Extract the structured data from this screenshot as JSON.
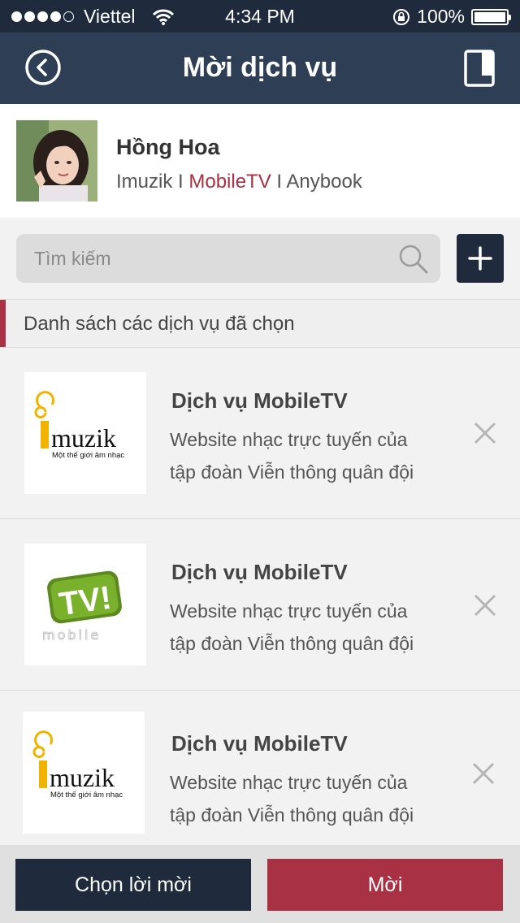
{
  "status_bar": {
    "carrier": "Viettel",
    "time": "4:34 PM",
    "battery": "100%",
    "signal_bars": 4
  },
  "nav": {
    "title": "Mời dịch vụ",
    "back_icon": "back-circle-icon",
    "doc_icon": "document-icon"
  },
  "profile": {
    "name": "Hồng Hoa",
    "services": [
      "Imuzik",
      "MobileTV",
      "Anybook"
    ],
    "separator": " I "
  },
  "search": {
    "placeholder": "Tìm kiếm",
    "value": ""
  },
  "section": {
    "title": "Danh sách các dịch vụ đã chọn"
  },
  "services": [
    {
      "title": "Dịch vụ MobileTV",
      "desc_line1": "Website nhạc trực tuyến của",
      "desc_line2": "tập đoàn Viễn thông quân đội",
      "logo": "imuzik",
      "logo_text": "muzik",
      "logo_tagline": "Một thế giới âm nhạc"
    },
    {
      "title": "Dịch vụ MobileTV",
      "desc_line1": "Website nhạc trực tuyến của",
      "desc_line2": "tập đoàn Viễn thông quân đội",
      "logo": "mobiletv",
      "logo_text": "TV!",
      "logo_tagline": "mobile"
    },
    {
      "title": "Dịch vụ MobileTV",
      "desc_line1": "Website nhạc trực tuyến của",
      "desc_line2": "tập đoàn Viễn thông quân đội",
      "logo": "imuzik",
      "logo_text": "muzik",
      "logo_tagline": "Một thế giới âm nhạc"
    }
  ],
  "buttons": {
    "choose": "Chọn lời mời",
    "invite": "Mời"
  },
  "colors": {
    "navy": "#2d3e55",
    "dark_navy": "#1f2b3d",
    "accent_red": "#a83244"
  }
}
